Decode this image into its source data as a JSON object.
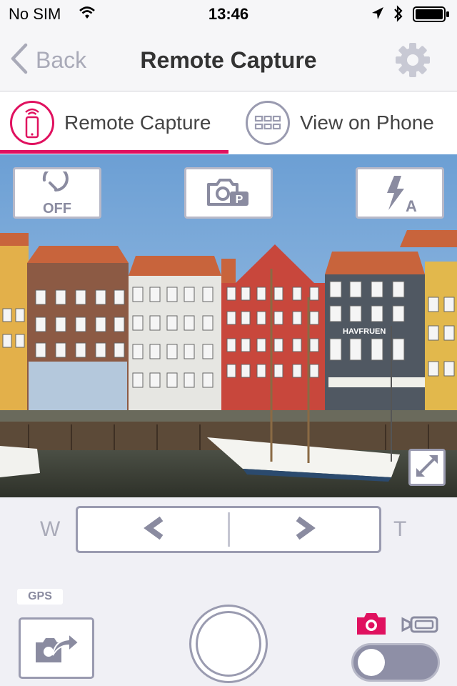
{
  "status_bar": {
    "carrier": "No SIM",
    "time": "13:46"
  },
  "nav": {
    "back_label": "Back",
    "title": "Remote Capture"
  },
  "tabs": [
    {
      "label": "Remote Capture",
      "active": true
    },
    {
      "label": "View on Phone",
      "active": false
    }
  ],
  "liveview": {
    "timer_label": "OFF",
    "flash_mode": "A",
    "sign_text": "HAVFRUEN"
  },
  "zoom": {
    "wide_label": "W",
    "tele_label": "T"
  },
  "bottom": {
    "gps_label": "GPS",
    "mode": "photo"
  },
  "colors": {
    "accent": "#e0115f",
    "control_gray": "#9a9bb0",
    "background": "#f0f0f5"
  }
}
